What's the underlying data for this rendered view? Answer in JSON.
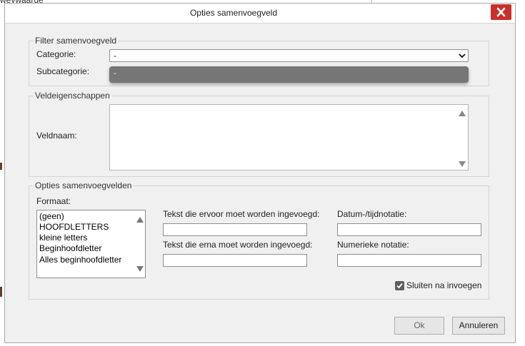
{
  "background": {
    "fragment_text": "weywaarde"
  },
  "dialog": {
    "title": "Opties samenvoegveld",
    "close_label": "✕"
  },
  "filter_group": {
    "legend": "Filter samenvoegveld",
    "category_label": "Categorie:",
    "category_value": "-",
    "subcategory_label": "Subcategorie:",
    "dropdown_options": [
      "-"
    ]
  },
  "field_props_group": {
    "legend": "Veldeigenschappen",
    "fieldname_label": "Veldnaam:"
  },
  "options_group": {
    "legend": "Opties samenvoegvelden",
    "format_label": "Formaat:",
    "format_items": [
      "(geen)",
      "HOOFDLETTERS",
      "kleine letters",
      "Beginhoofdletter",
      "Alles beginhoofdletter"
    ],
    "text_before_label": "Tekst die ervoor moet worden ingevoegd:",
    "text_after_label": "Tekst die erna moet worden ingevoegd:",
    "datetime_label": "Datum-/tijdnotatie:",
    "numeric_label": "Numerieke notatie:",
    "close_after_insert_label": "Sluiten na invoegen",
    "close_after_insert_checked": true
  },
  "buttons": {
    "ok_label": "Ok",
    "cancel_label": "Annuleren"
  },
  "colors": {
    "close_button": "#c9302c",
    "dialog_bg": "#f0f0f0",
    "dropdown_popup": "#767676",
    "checkbox": "#5f5f5f"
  },
  "icons": {
    "close": "close-icon",
    "dropdown": "chevron-down-icon",
    "scroll_up": "triangle-up-icon",
    "scroll_down": "triangle-down-icon",
    "check": "checkmark-icon"
  }
}
